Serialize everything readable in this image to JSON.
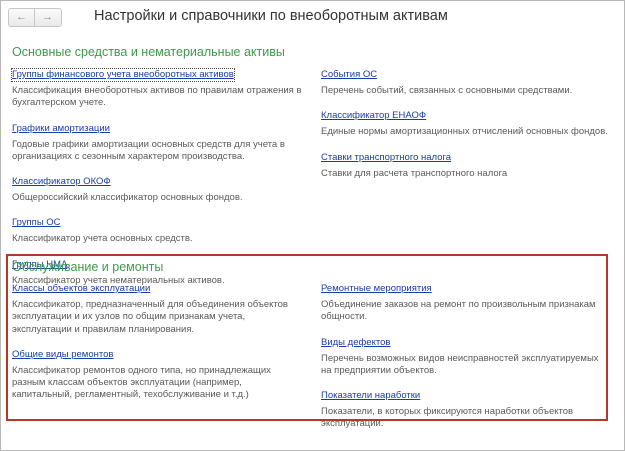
{
  "nav": {
    "back_icon": "arrow-left-icon",
    "forward_icon": "arrow-right-icon"
  },
  "page_title": "Настройки и справочники по внеоборотным активам",
  "sections": {
    "fixed_assets": {
      "title": "Основные средства и нематериальные активы",
      "left": [
        {
          "label": "Группы финансового учета внеоборотных активов",
          "description": "Классификация внеоборотных активов по правилам отражения в бухгалтерском учете."
        },
        {
          "label": "Графики амортизации",
          "description": "Годовые графики амортизации основных средств для учета в организациях с сезонным характером производства."
        },
        {
          "label": "Классификатор ОКОФ",
          "description": "Общероссийский классификатор основных фондов."
        },
        {
          "label": "Группы ОС",
          "description": "Классификатор учета основных средств."
        },
        {
          "label": "Группы НМА",
          "description": "Классификатор учета нематериальных активов."
        }
      ],
      "right": [
        {
          "label": "События ОС",
          "description": "Перечень событий, связанных с основными средствами."
        },
        {
          "label": "Классификатор ЕНАОФ",
          "description": "Единые нормы амортизационных отчислений основных фондов."
        },
        {
          "label": "Ставки транспортного налога",
          "description": "Ставки для расчета транспортного налога"
        }
      ]
    },
    "maintenance": {
      "title": "Обслуживание и ремонты",
      "left": [
        {
          "label": "Классы объектов эксплуатации",
          "description": "Классификатор, предназначенный для объединения объектов эксплуатации и их узлов по общим признакам учета, эксплуатации и правилам планирования."
        },
        {
          "label": "Общие виды ремонтов",
          "description": "Классификатор ремонтов одного типа, но принадлежащих разным классам объектов эксплуатации (например, капитальный, регламентный, техобслуживание и т.д.)"
        }
      ],
      "right": [
        {
          "label": "Ремонтные мероприятия",
          "description": "Объединение заказов на ремонт по произвольным признакам общности."
        },
        {
          "label": "Виды дефектов",
          "description": "Перечень возможных видов неисправностей эксплуатируемых на предприятии объектов."
        },
        {
          "label": "Показатели наработки",
          "description": "Показатели, в которых фиксируются наработки объектов эксплуатации."
        }
      ]
    }
  }
}
